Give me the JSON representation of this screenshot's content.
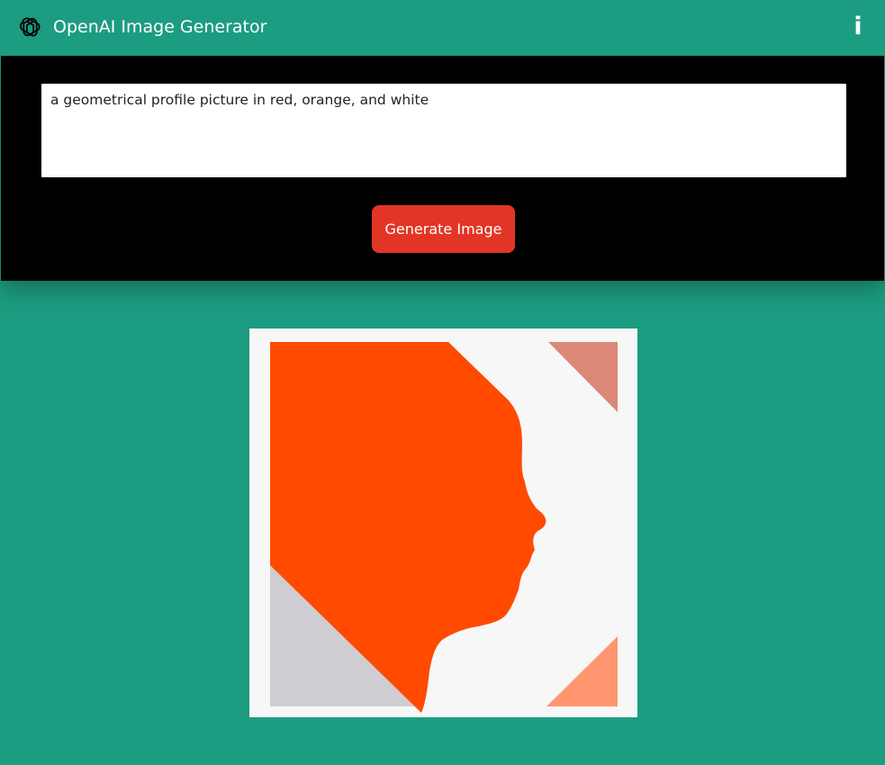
{
  "header": {
    "title": "OpenAI Image Generator",
    "logo_icon": "openai-logo-icon",
    "info_label": "i",
    "info_icon": "info-icon"
  },
  "prompt": {
    "value": "a geometrical profile picture in red, orange, and white",
    "placeholder": ""
  },
  "actions": {
    "generate_label": "Generate Image"
  },
  "result": {
    "description_icon": "generated-image",
    "colors": {
      "background": "#f7f7f7",
      "profile": "#ff4a00",
      "gray_triangle": "#cfcdd2",
      "top_triangle": "#dc8878",
      "bottom_triangle": "#ff9670"
    }
  },
  "theme": {
    "brand": "#1c9c80",
    "panel": "#000000",
    "accent": "#e33525"
  }
}
